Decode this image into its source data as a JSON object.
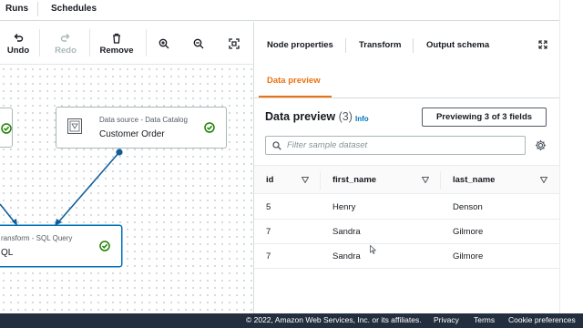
{
  "top_tabs": [
    "Runs",
    "Schedules"
  ],
  "toolbar": {
    "undo": "Undo",
    "redo": "Redo",
    "remove": "Remove"
  },
  "canvas": {
    "node_left_status": "succeeded",
    "source_node": {
      "label": "Data source - Data Catalog",
      "title": "Customer Order",
      "status": "succeeded"
    },
    "transform_node": {
      "label": "Transform - SQL Query",
      "title": "SQL",
      "label_visible": "ransform - SQL Query",
      "title_visible": "QL",
      "status": "succeeded"
    }
  },
  "right_panel": {
    "tabs": [
      "Node properties",
      "Transform",
      "Output schema"
    ],
    "active_tab": "Data preview",
    "header": "Data preview",
    "count": "(3)",
    "info": "Info",
    "preview_button": "Previewing 3 of 3 fields",
    "filter_placeholder": "Filter sample dataset",
    "columns": [
      "id",
      "first_name",
      "last_name"
    ],
    "rows": [
      [
        "5",
        "Henry",
        "Denson"
      ],
      [
        "7",
        "Sandra",
        "Gilmore"
      ],
      [
        "7",
        "Sandra",
        "Gilmore"
      ]
    ]
  },
  "footer": {
    "copyright": "© 2022, Amazon Web Services, Inc. or its affiliates.",
    "privacy": "Privacy",
    "terms": "Terms",
    "cookies": "Cookie preferences"
  },
  "colors": {
    "accent": "#ec7211",
    "link": "#0073bb",
    "success": "#1d8102",
    "footer_bg": "#232f3e"
  }
}
